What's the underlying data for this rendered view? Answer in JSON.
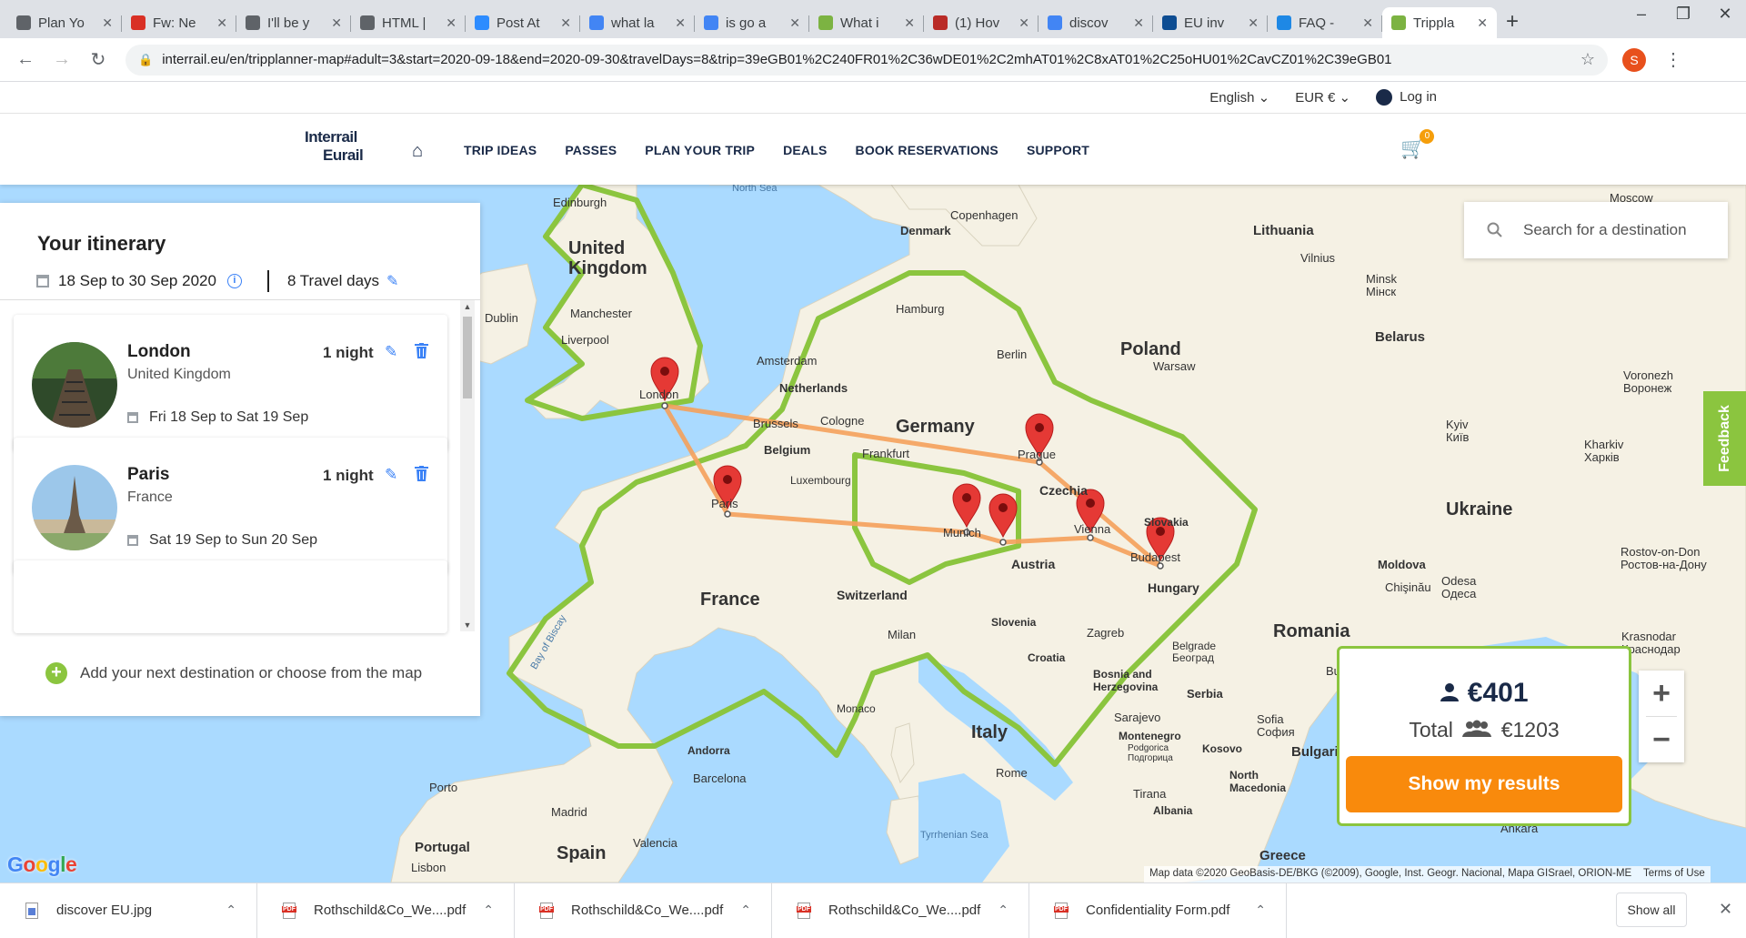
{
  "browser": {
    "tabs": [
      {
        "label": "Plan Yo",
        "color": "#5f6368",
        "icon": "globe-icon"
      },
      {
        "label": "Fw: Ne",
        "color": "#d93025",
        "icon": "gmail-icon"
      },
      {
        "label": "I'll be y",
        "color": "#5f6368",
        "icon": "wattpad-icon"
      },
      {
        "label": "HTML |",
        "color": "#5f6368",
        "icon": "wattpad-icon"
      },
      {
        "label": "Post At",
        "color": "#2d8cff",
        "icon": "zoom-icon"
      },
      {
        "label": "what la",
        "color": "#4285f4",
        "icon": "google-icon"
      },
      {
        "label": "is go a",
        "color": "#4285f4",
        "icon": "google-icon"
      },
      {
        "label": "What i",
        "color": "#7cb342",
        "icon": "interrail-icon"
      },
      {
        "label": "(1) Hov",
        "color": "#b92b27",
        "icon": "quora-icon"
      },
      {
        "label": "discov",
        "color": "#4285f4",
        "icon": "google-icon"
      },
      {
        "label": "EU inv",
        "color": "#0e4d92",
        "icon": "eu-icon"
      },
      {
        "label": "FAQ -",
        "color": "#1e88e5",
        "icon": "faq-icon"
      },
      {
        "label": "Trippla",
        "color": "#7cb342",
        "icon": "interrail-icon",
        "active": true
      }
    ],
    "url": "interrail.eu/en/tripplanner-map#adult=3&start=2020-09-18&end=2020-09-30&travelDays=8&trip=39eGB01%2C240FR01%2C36wDE01%2C2mhAT01%2C8xAT01%2C25oHU01%2CavCZ01%2C39eGB01",
    "profile_initial": "S"
  },
  "site": {
    "language": "English",
    "currency": "EUR €",
    "login": "Log in",
    "logo_line1": "Interrail",
    "logo_line2": "Eurail",
    "nav": [
      "TRIP IDEAS",
      "PASSES",
      "PLAN YOUR TRIP",
      "DEALS",
      "BOOK RESERVATIONS",
      "SUPPORT"
    ],
    "cart_count": "0"
  },
  "itinerary": {
    "title": "Your itinerary",
    "dates": "18 Sep to 30 Sep 2020",
    "travel_days": "8 Travel days",
    "stops": [
      {
        "city": "London",
        "country": "United Kingdom",
        "nights": "1 night",
        "range": "Fri 18 Sep to Sat 19 Sep"
      },
      {
        "city": "Paris",
        "country": "France",
        "nights": "1 night",
        "range": "Sat 19 Sep to Sun 20 Sep"
      }
    ],
    "add_destination": "Add your next destination or choose from the map"
  },
  "search": {
    "placeholder": "Search for a destination"
  },
  "feedback": "Feedback",
  "price": {
    "per_person": "€401",
    "total_label": "Total",
    "total": "€1203",
    "button": "Show my results"
  },
  "map": {
    "attribution": "Map data ©2020 GeoBasis-DE/BKG (©2009), Google, Inst. Geogr. Nacional, Mapa GISrael, ORION-ME",
    "terms": "Terms of Use",
    "google": "Google",
    "country_labels": {
      "uk": "United Kingdom",
      "france": "France",
      "germany": "Germany",
      "poland": "Poland",
      "ukraine": "Ukraine",
      "romania": "Romania",
      "italy": "Italy",
      "spain": "Spain",
      "belarus": "Belarus",
      "lithuania": "Lithuania",
      "austria": "Austria",
      "hungary": "Hungary",
      "czechia": "Czechia",
      "switzerland": "Switzerland",
      "belgium": "Belgium",
      "netherlands": "Netherlands",
      "denmark": "Denmark",
      "portugal": "Portugal",
      "moldova": "Moldova",
      "serbia": "Serbia",
      "slovenia": "Slovenia",
      "croatia": "Croatia",
      "slovakia": "Slovakia",
      "bosnia": "Bosnia and Herzegovina",
      "albania": "Albania",
      "kosovo": "Kosovo",
      "n_macedonia": "North Macedonia",
      "greece": "Greece",
      "bulgaria": "Bulgaria"
    },
    "city_labels": {
      "london": "London",
      "paris": "Paris",
      "munich": "Munich",
      "prague": "Prague",
      "vienna": "Vienna",
      "budapest": "Budapest",
      "berlin": "Berlin",
      "hamburg": "Hamburg",
      "amsterdam": "Amsterdam",
      "brussels": "Brussels",
      "frankfurt": "Frankfurt",
      "cologne": "Cologne",
      "luxembourg": "Luxembourg",
      "warsaw": "Warsaw",
      "vilnius": "Vilnius",
      "minsk": "Minsk\nМінск",
      "kyiv": "Kyiv\nКиїв",
      "kharkiv": "Kharkiv\nХарків",
      "voronezh": "Voronezh\nВоронеж",
      "odesa": "Odesa\nОдеса",
      "chisinau": "Chişinău",
      "rostov": "Rostov-on-Don\nРостов-на-Дону",
      "krasnodar": "Krasnodar\nКраснодар",
      "moscow": "Moscow",
      "copenhagen": "Copenhagen",
      "edinburgh": "Edinburgh",
      "dublin": "Dublin",
      "manchester": "Manchester",
      "liverpool": "Liverpool",
      "milan": "Milan",
      "monaco": "Monaco",
      "rome": "Rome",
      "zagreb": "Zagreb",
      "belgrade": "Belgrade\nБеоград",
      "sarajevo": "Sarajevo",
      "sofia": "Sofia\nСофия",
      "podgorica": "Podgorica\nПодгорица",
      "montenegro": "Montenegro",
      "tirana": "Tirana",
      "barcelona": "Barcelona",
      "madrid": "Madrid",
      "valencia": "Valencia",
      "porto": "Porto",
      "lisbon": "Lisbon",
      "andorra": "Andorra",
      "ankara": "Ankara",
      "bucharest": "Buc",
      "north_sea": "North Sea",
      "bay_of_biscay": "Bay of Biscay",
      "tyrrhenian_sea": "Tyrrhenian Sea"
    }
  }
}
